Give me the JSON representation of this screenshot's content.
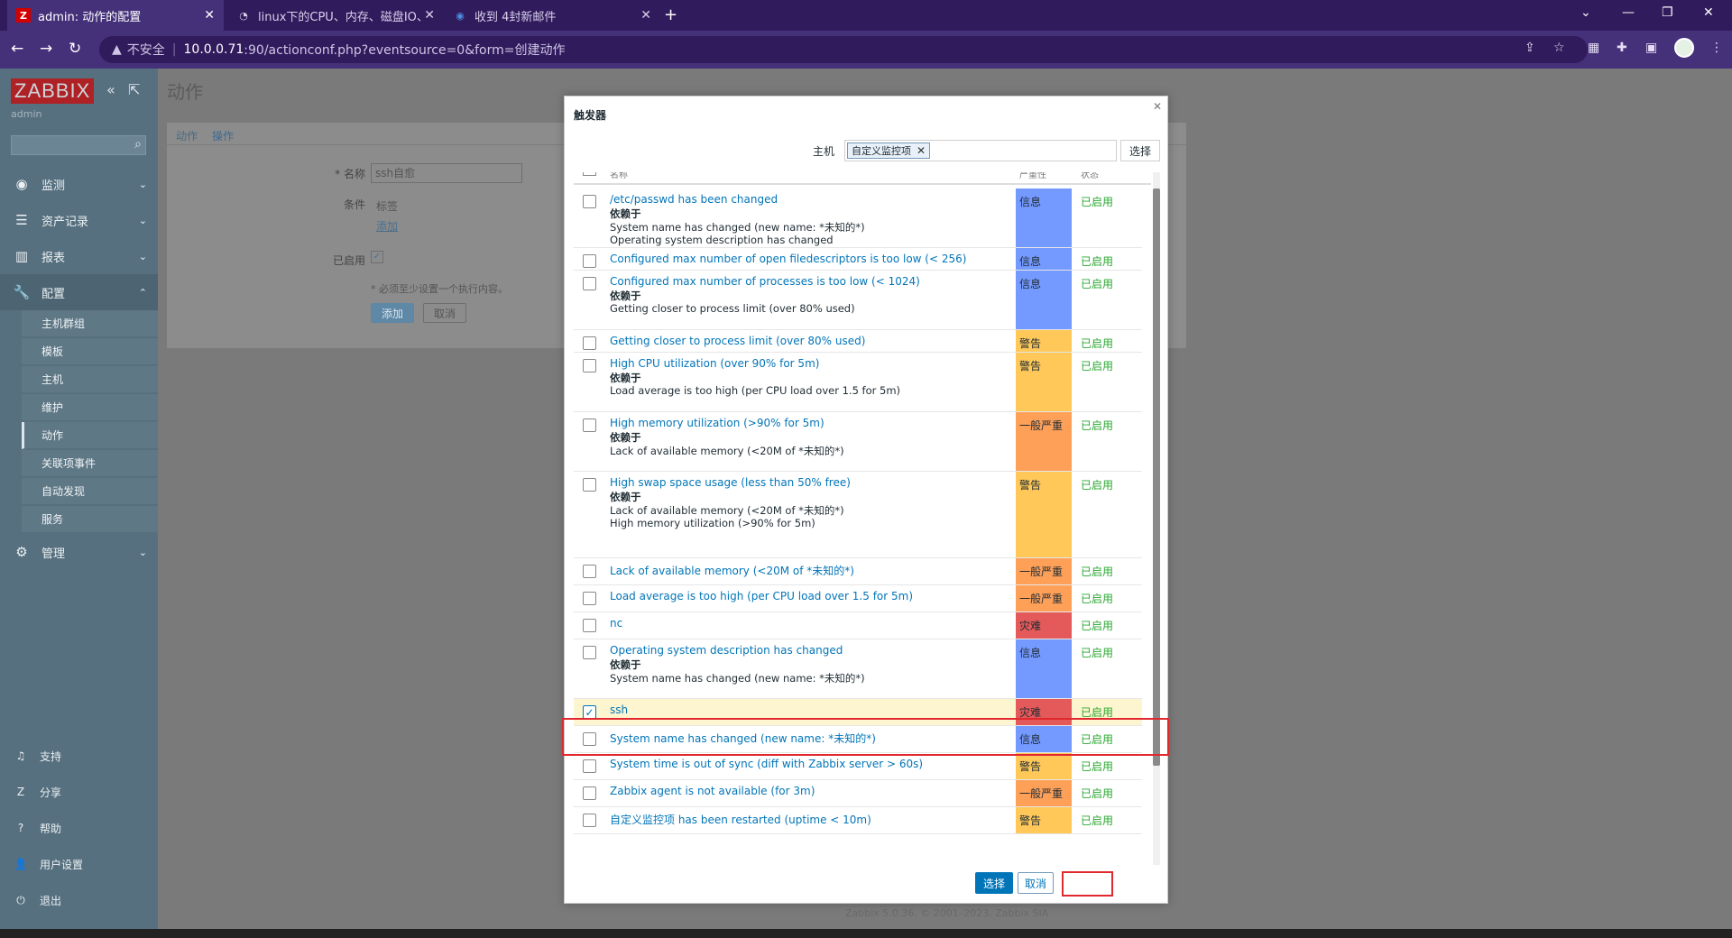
{
  "browser": {
    "tabs": [
      {
        "label": "admin: 动作的配置",
        "icon": "Z"
      },
      {
        "label": "linux下的CPU、内存、磁盘IO、",
        "icon": "◔"
      },
      {
        "label": "收到 4封新邮件",
        "icon": "◉"
      }
    ],
    "insecure_label": "不安全",
    "url_host": "10.0.0.71",
    "url_rest": ":90/actionconf.php?eventsource=0&form=创建动作"
  },
  "sidebar": {
    "logo": "ZABBIX",
    "user": "admin",
    "menus": [
      {
        "label": "监测",
        "icon": "◉"
      },
      {
        "label": "资产记录",
        "icon": "☰"
      },
      {
        "label": "报表",
        "icon": "▥"
      },
      {
        "label": "配置",
        "icon": "🔧"
      },
      {
        "label": "管理",
        "icon": "⚙"
      }
    ],
    "submenus": [
      "主机群组",
      "模板",
      "主机",
      "维护",
      "动作",
      "关联项事件",
      "自动发现",
      "服务"
    ],
    "bottom": [
      {
        "label": "支持",
        "icon": "♫"
      },
      {
        "label": "分享",
        "icon": "Z"
      },
      {
        "label": "帮助",
        "icon": "?"
      },
      {
        "label": "用户设置",
        "icon": "👤"
      },
      {
        "label": "退出",
        "icon": "⏻"
      }
    ]
  },
  "page": {
    "title": "动作",
    "tabs": [
      "动作",
      "操作"
    ],
    "name_label": "* 名称",
    "name_value": "ssh自愈",
    "conditions_label": "条件",
    "conditions_col": "标签",
    "add_link": "添加",
    "enabled_label": "已启用",
    "note": "* 必须至少设置一个执行内容。",
    "add_button": "添加",
    "cancel_button": "取消",
    "footer": "Zabbix 5.0.36. © 2001–2023, Zabbix SIA"
  },
  "modal": {
    "title": "触发器",
    "host_label": "主机",
    "host_chip": "自定义监控项",
    "select_button": "选择",
    "col_name": "名称",
    "col_severity": "严重性",
    "col_status": "状态",
    "rows": [
      {
        "name": "/etc/passwd has been changed",
        "deps_title": "依赖于",
        "deps": [
          "System name has changed (new name: *未知的*)",
          "Operating system description has changed"
        ],
        "severity": "信息",
        "status": "已启用",
        "checked": false
      },
      {
        "name": "Configured max number of open filedescriptors is too low (< 256)",
        "deps_title": "",
        "deps": [],
        "severity": "信息",
        "status": "已启用",
        "checked": false
      },
      {
        "name": "Configured max number of processes is too low (< 1024)",
        "deps_title": "依赖于",
        "deps": [
          "Getting closer to process limit (over 80% used)"
        ],
        "severity": "信息",
        "status": "已启用",
        "checked": false
      },
      {
        "name": "Getting closer to process limit (over 80% used)",
        "deps_title": "",
        "deps": [],
        "severity": "警告",
        "status": "已启用",
        "checked": false
      },
      {
        "name": "High CPU utilization (over 90% for 5m)",
        "deps_title": "依赖于",
        "deps": [
          "Load average is too high (per CPU load over 1.5 for 5m)"
        ],
        "severity": "警告",
        "status": "已启用",
        "checked": false
      },
      {
        "name": "High memory utilization (>90% for 5m)",
        "deps_title": "依赖于",
        "deps": [
          "Lack of available memory (<20M of *未知的*)"
        ],
        "severity": "一般严重",
        "status": "已启用",
        "checked": false
      },
      {
        "name": "High swap space usage (less than 50% free)",
        "deps_title": "依赖于",
        "deps": [
          "Lack of available memory (<20M of *未知的*)",
          "High memory utilization (>90% for 5m)"
        ],
        "severity": "警告",
        "status": "已启用",
        "checked": false
      },
      {
        "name": "Lack of available memory (<20M of *未知的*)",
        "deps_title": "",
        "deps": [],
        "severity": "一般严重",
        "status": "已启用",
        "checked": false
      },
      {
        "name": "Load average is too high (per CPU load over 1.5 for 5m)",
        "deps_title": "",
        "deps": [],
        "severity": "一般严重",
        "status": "已启用",
        "checked": false
      },
      {
        "name": "nc",
        "deps_title": "",
        "deps": [],
        "severity": "灾难",
        "status": "已启用",
        "checked": false
      },
      {
        "name": "Operating system description has changed",
        "deps_title": "依赖于",
        "deps": [
          "System name has changed (new name: *未知的*)"
        ],
        "severity": "信息",
        "status": "已启用",
        "checked": false
      },
      {
        "name": "ssh",
        "deps_title": "",
        "deps": [],
        "severity": "灾难",
        "status": "已启用",
        "checked": true
      },
      {
        "name": "System name has changed (new name: *未知的*)",
        "deps_title": "",
        "deps": [],
        "severity": "信息",
        "status": "已启用",
        "checked": false
      },
      {
        "name": "System time is out of sync (diff with Zabbix server > 60s)",
        "deps_title": "",
        "deps": [],
        "severity": "警告",
        "status": "已启用",
        "checked": false
      },
      {
        "name": "Zabbix agent is not available (for 3m)",
        "deps_title": "",
        "deps": [],
        "severity": "一般严重",
        "status": "已启用",
        "checked": false
      },
      {
        "name": "自定义监控项 has been restarted (uptime < 10m)",
        "deps_title": "",
        "deps": [],
        "severity": "警告",
        "status": "已启用",
        "checked": false
      }
    ],
    "ok_button": "选择",
    "cancel_button": "取消"
  },
  "colors": {
    "severity": {
      "信息": "#7499ff",
      "警告": "#ffc859",
      "一般严重": "#ffa059",
      "灾难": "#e45959"
    },
    "link": "#0275b8",
    "enabled": "#2aa730",
    "highlight_box": "#e0282e"
  }
}
